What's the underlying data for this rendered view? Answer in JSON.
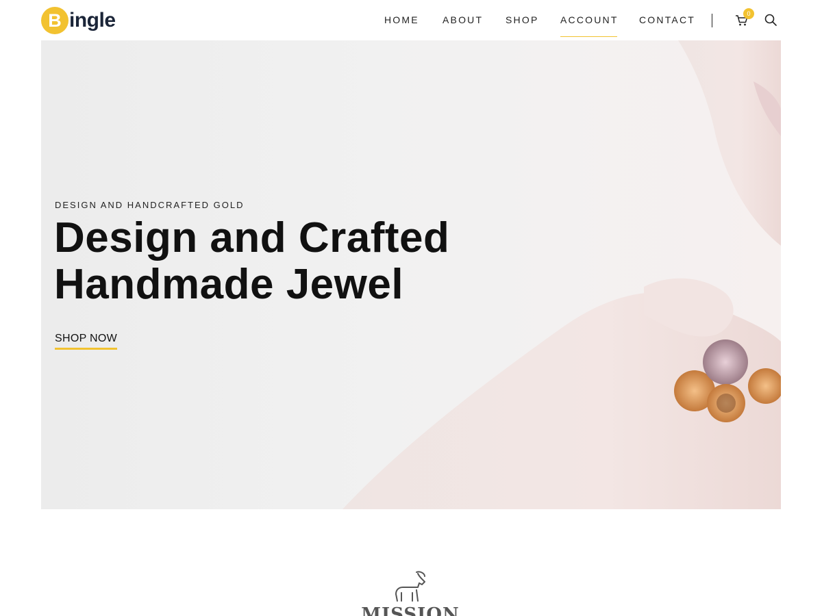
{
  "brand": {
    "logo_letter": "B",
    "logo_text": "ingle",
    "accent": "#f2c230",
    "text_color": "#1b2538"
  },
  "nav": {
    "items": [
      {
        "label": "HOME"
      },
      {
        "label": "ABOUT"
      },
      {
        "label": "SHOP"
      },
      {
        "label": "ACCOUNT"
      },
      {
        "label": "CONTACT"
      }
    ],
    "active": "ACCOUNT"
  },
  "cart": {
    "count": "0",
    "icon": "cart-icon"
  },
  "search": {
    "icon": "search-icon"
  },
  "hero": {
    "eyebrow": "DESIGN AND HANDCRAFTED GOLD",
    "headline_line1": "Design and Crafted",
    "headline_line2": "Handmade Jewel",
    "cta": "SHOP NOW"
  },
  "mission": {
    "emblem_text": "MISSION",
    "icon": "goat-emblem-icon"
  }
}
